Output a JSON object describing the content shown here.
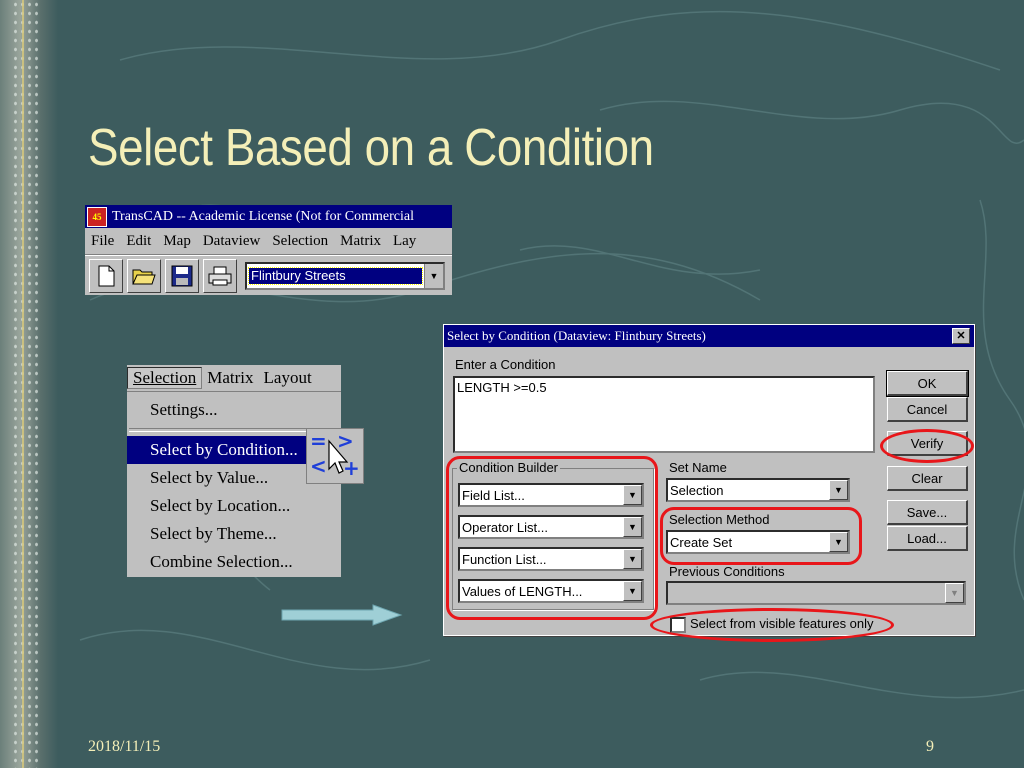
{
  "slide": {
    "title": "Select Based on a Condition",
    "date": "2018/11/15",
    "page_number": "9"
  },
  "transcad_window": {
    "title": "TransCAD -- Academic License (Not for Commercial",
    "app_icon_text": "45",
    "menu": [
      "File",
      "Edit",
      "Map",
      "Dataview",
      "Selection",
      "Matrix",
      "Lay"
    ],
    "toolbar_icons": [
      "new-file-icon",
      "open-folder-icon",
      "save-disk-icon",
      "print-icon"
    ],
    "layer_combo_value": "Flintbury Streets"
  },
  "selection_menu": {
    "menubar": [
      "Selection",
      "Matrix",
      "Layout"
    ],
    "active_menu": "Selection",
    "items": [
      {
        "label": "Settings...",
        "highlighted": false
      },
      {
        "label": "Select by Condition...",
        "highlighted": true
      },
      {
        "label": "Select by Value...",
        "highlighted": false
      },
      {
        "label": "Select by Location...",
        "highlighted": false
      },
      {
        "label": "Select by Theme...",
        "highlighted": false
      },
      {
        "label": "Combine Selection...",
        "highlighted": false
      }
    ],
    "tool_icon": "select-by-condition-tool-icon"
  },
  "dialog": {
    "title": "Select by Condition (Dataview: Flintbury Streets)",
    "enter_condition_label": "Enter a Condition",
    "condition_text": "LENGTH >=0.5",
    "buttons": {
      "ok": "OK",
      "cancel": "Cancel",
      "verify": "Verify",
      "clear": "Clear",
      "save": "Save...",
      "load": "Load..."
    },
    "condition_builder": {
      "label": "Condition Builder",
      "field_list": "Field List...",
      "operator_list": "Operator List...",
      "function_list": "Function List...",
      "values_list": "Values of LENGTH..."
    },
    "set_name_label": "Set Name",
    "set_name_value": "Selection",
    "selection_method_label": "Selection Method",
    "selection_method_value": "Create Set",
    "previous_conditions_label": "Previous Conditions",
    "previous_conditions_value": "",
    "visible_only_label": "Select from visible features only",
    "visible_only_checked": false
  },
  "colors": {
    "background": "#3d5c5e",
    "title_text": "#f4efb8",
    "highlight_oval": "#e8161a",
    "window_titlebar": "#000080",
    "window_face": "#c0c0c0"
  }
}
